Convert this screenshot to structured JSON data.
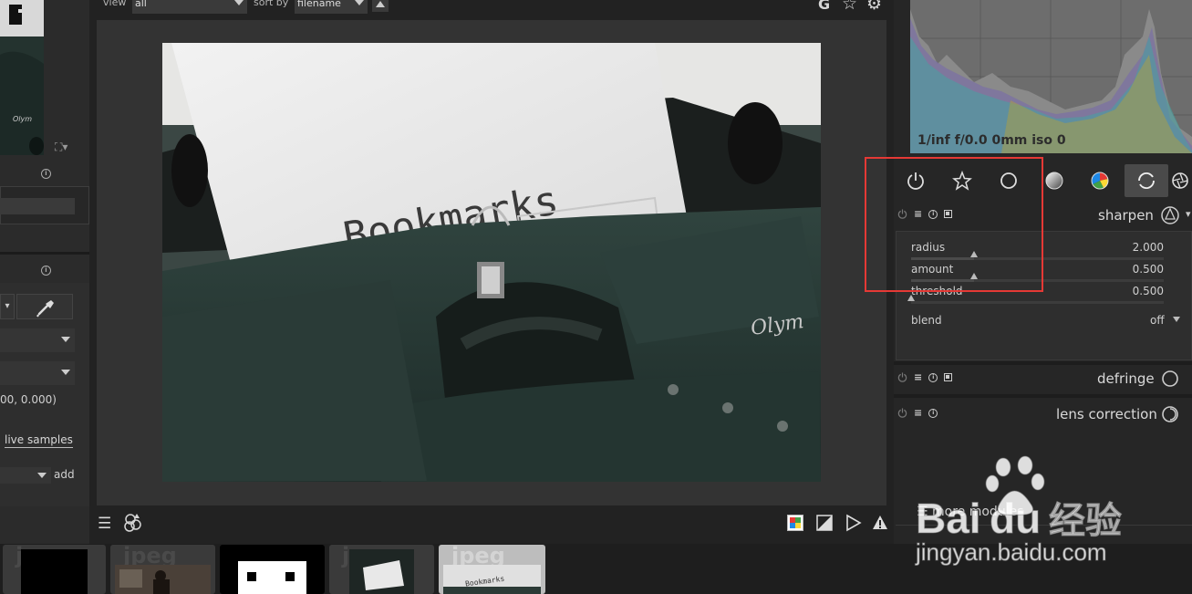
{
  "toolbar": {
    "view_label": "view",
    "view_value": "all",
    "sort_label": "sort by",
    "sort_value": "filename",
    "icons": [
      "grouping-icon",
      "star-icon",
      "gear-icon"
    ],
    "grouping_glyph": "G"
  },
  "left_panel": {
    "coords_text": "00, 0.000)",
    "live_samples_label": "live samples",
    "add_label": "add"
  },
  "center": {
    "photo_text": "Bookmarks",
    "photo_brand": "Olym"
  },
  "bottom_toolbar": {
    "icons": [
      "hamburger-icon",
      "styles-icon",
      "color-picker-icon",
      "softproof-icon",
      "gamut-check-icon",
      "warning-icon"
    ]
  },
  "filmstrip": {
    "ext_label": "jpeg",
    "thumb_text": "Bookmarks"
  },
  "histogram": {
    "exif": "1/inf f/0.0 0mm iso 0"
  },
  "module_tabs": [
    "power-icon",
    "favorite-icon",
    "circle-icon",
    "gradient-circle-icon",
    "color-wheel-icon",
    "refresh-icon",
    "aperture-icon"
  ],
  "modules": {
    "sharpen": {
      "name": "sharpen",
      "radius_label": "radius",
      "radius_value": "2.000",
      "radius_level": 0.25,
      "amount_label": "amount",
      "amount_value": "0.500",
      "amount_level": 0.25,
      "threshold_label": "threshold",
      "threshold_value": "0.500",
      "threshold_level": 0.0,
      "blend_label": "blend",
      "blend_value": "off"
    },
    "defringe": {
      "name": "defringe"
    },
    "lens_correction": {
      "name": "lens correction"
    }
  },
  "more_modules_label": "more modules",
  "watermark": {
    "brand": "Bai",
    "brand2": "du",
    "cn": "经验",
    "url": "jingyan.baidu.com"
  },
  "colors": {
    "highlight": "#e53935",
    "panel_bg": "#262626"
  }
}
